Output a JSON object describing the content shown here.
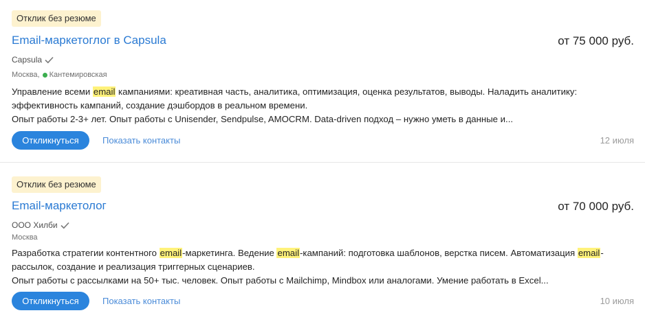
{
  "vacancies": [
    {
      "badge": "Отклик без резюме",
      "title": "Email-маркетоглог в Capsula",
      "salary": "от 75 000 руб.",
      "company": "Capsula",
      "city": "Москва,",
      "metro": "Кантемировская",
      "desc_line1": [
        {
          "t": "Управление всеми ",
          "h": false
        },
        {
          "t": "email",
          "h": true
        },
        {
          "t": " кампаниями: креативная часть, аналитика, оптимизация, оценка результатов, выводы. Наладить аналитику:",
          "h": false
        }
      ],
      "desc_line2": "эффективность кампаний, создание дэшбордов в реальном времени.",
      "desc_line3": "Опыт работы 2-3+ лет. Опыт работы с Unisender, Sendpulse, AMOCRM. Data-driven подход – нужно уметь в данные и...",
      "apply_label": "Откликнуться",
      "contacts_label": "Показать контакты",
      "date": "12 июля"
    },
    {
      "badge": "Отклик без резюме",
      "title": "Email-маркетолог",
      "salary": "от 70 000 руб.",
      "company": "ООО Хилби",
      "city": "Москва",
      "desc_line1": [
        {
          "t": "Разработка стратегии контентного ",
          "h": false
        },
        {
          "t": "email",
          "h": true
        },
        {
          "t": "-маркетинга. Ведение ",
          "h": false
        },
        {
          "t": "email",
          "h": true
        },
        {
          "t": "-кампаний: подготовка шаблонов, верстка писем. Автоматизация ",
          "h": false
        },
        {
          "t": "email",
          "h": true
        },
        {
          "t": "-",
          "h": false
        }
      ],
      "desc_line2": "рассылок, создание и реализация триггерных сценариев.",
      "desc_line3": "Опыт работы с рассылками на 50+ тыс. человек. Опыт работы с Mailchimp, Mindbox или аналогами. Умение работать в Excel...",
      "apply_label": "Откликнуться",
      "contacts_label": "Показать контакты",
      "date": "10 июля"
    }
  ],
  "icons": {
    "verified": "checkmark-icon",
    "metro": "metro-dot-icon"
  },
  "colors": {
    "link": "#2a7ad3",
    "button": "#2b84dd",
    "badge_bg": "#fdf2cf",
    "highlight": "#fff27a",
    "metro": "#3cae4f"
  }
}
